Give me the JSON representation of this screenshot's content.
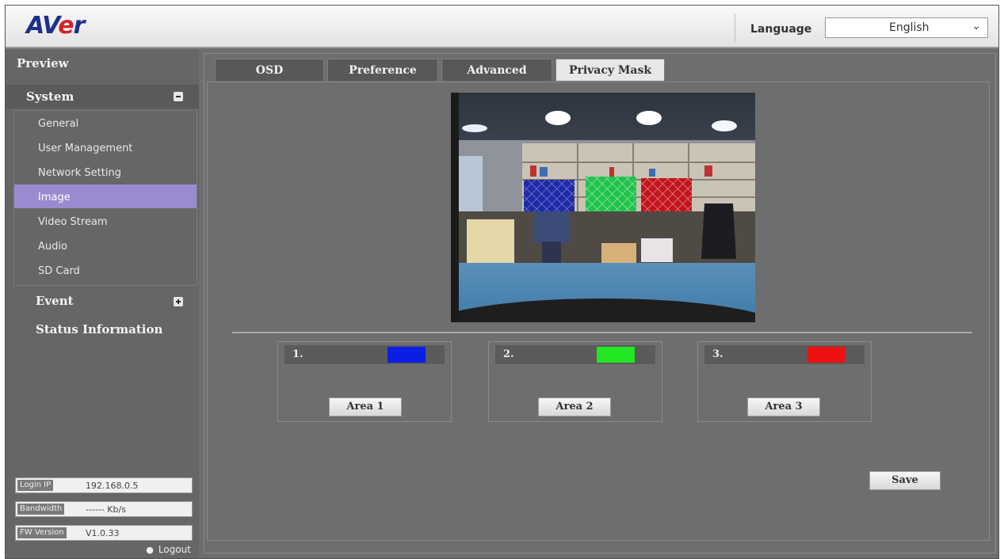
{
  "header": {
    "logo": {
      "av": "AV",
      "e": "e",
      "r": "r"
    },
    "language_label": "Language",
    "language_value": "English"
  },
  "sidebar": {
    "preview": "Preview",
    "system": "System",
    "system_items": [
      "General",
      "User Management",
      "Network Setting",
      "Image",
      "Video Stream",
      "Audio",
      "SD Card"
    ],
    "active_item": "Image",
    "event": "Event",
    "status": "Status Information",
    "info": [
      {
        "key": "Login IP",
        "value": "192.168.0.5"
      },
      {
        "key": "Bandwidth",
        "value": "------ Kb/s"
      },
      {
        "key": "FW Version",
        "value": "V1.0.33"
      }
    ],
    "logout": "Logout"
  },
  "tabs": [
    "OSD",
    "Preference",
    "Advanced",
    "Privacy Mask"
  ],
  "active_tab": "Privacy Mask",
  "areas": [
    {
      "num": "1.",
      "color": "#0a1ee6",
      "button": "Area 1"
    },
    {
      "num": "2.",
      "color": "#22e622",
      "button": "Area 2"
    },
    {
      "num": "3.",
      "color": "#ee1111",
      "button": "Area 3"
    }
  ],
  "save_label": "Save",
  "colors": {
    "accent": "#9b8ad0",
    "logo_blue": "#1e2f8c",
    "logo_red": "#d2232a",
    "mask_blue": "#1e2aa8",
    "mask_green": "#1fc44a",
    "mask_red": "#c4141c"
  }
}
